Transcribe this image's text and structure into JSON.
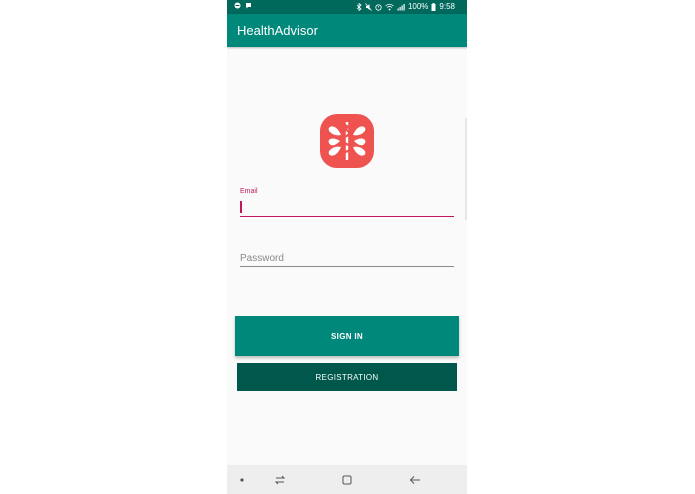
{
  "status_bar": {
    "battery_text": "100%",
    "time": "9:58"
  },
  "app_bar": {
    "title": "HealthAdvisor"
  },
  "logo": {
    "icon": "medical-star-of-life-icon",
    "color": "#ef5350"
  },
  "form": {
    "email_label": "Email",
    "email_value": "",
    "password_placeholder": "Password",
    "password_value": ""
  },
  "buttons": {
    "sign_in": "SIGN IN",
    "registration": "REGISTRATION"
  },
  "nav_bar": {
    "items": [
      "dot-icon",
      "recent-apps-icon",
      "home-icon",
      "back-icon"
    ]
  },
  "colors": {
    "primary": "#00897b",
    "primary_dark": "#00695c",
    "button_secondary": "#00574b",
    "accent": "#c2185b"
  }
}
